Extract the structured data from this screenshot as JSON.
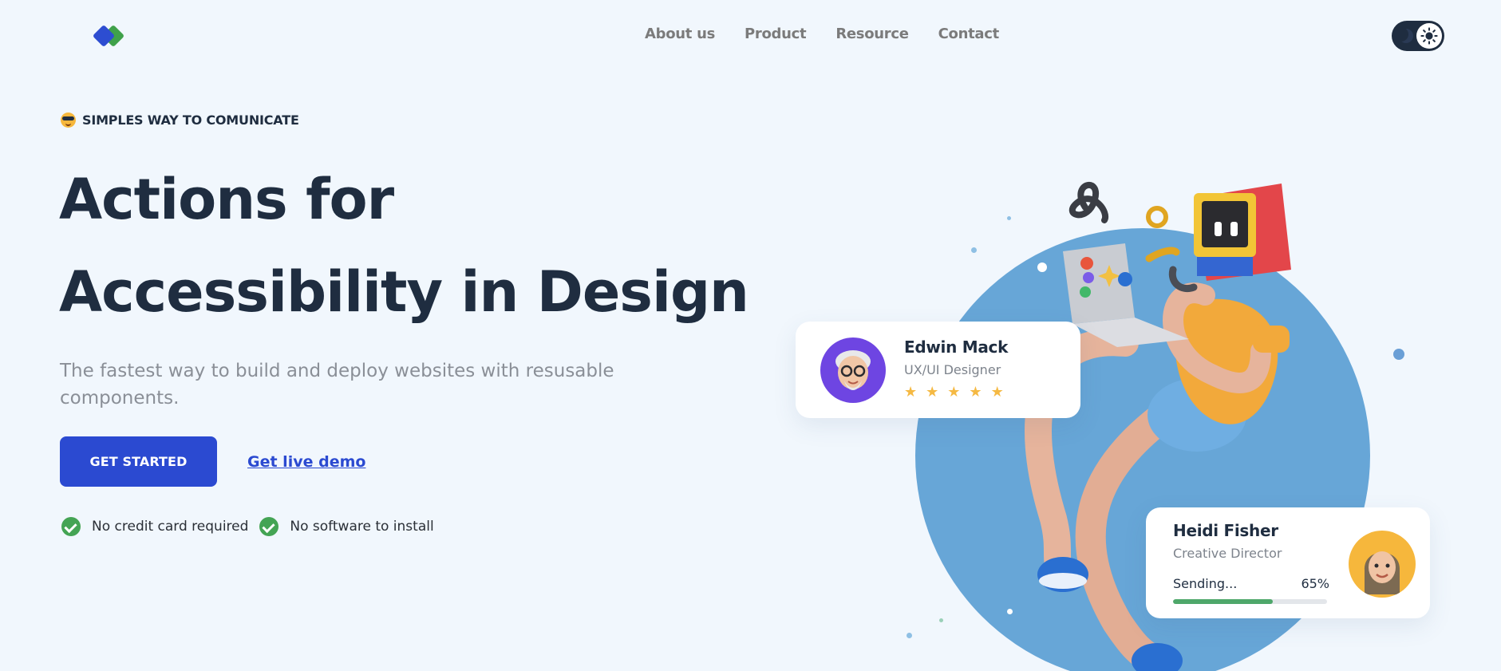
{
  "nav": {
    "items": [
      {
        "label": "About us"
      },
      {
        "label": "Product"
      },
      {
        "label": "Resource"
      },
      {
        "label": "Contact"
      }
    ],
    "logo_icon": "diamond-logo-icon",
    "theme_toggle_icon": "sun-icon"
  },
  "hero": {
    "tagline": "SIMPLES WAY TO COMUNICATE",
    "tagline_icon": "sunglasses-emoji-icon",
    "headline_line1": "Actions for",
    "headline_line2": "Accessibility in Design",
    "subtitle": "The fastest way to build and deploy websites with resusable components.",
    "cta_primary": "GET STARTED",
    "cta_secondary": "Get live demo",
    "checks": [
      {
        "label": "No credit card required"
      },
      {
        "label": "No software to install"
      }
    ]
  },
  "cards": {
    "edwin": {
      "name": "Edwin Mack",
      "role": "UX/UI Designer",
      "rating": 5
    },
    "heidi": {
      "name": "Heidi Fisher",
      "role": "Creative Director",
      "sending_label": "Sending...",
      "progress_text": "65%",
      "progress": 0.65
    }
  },
  "colors": {
    "primary": "#2b4ad1",
    "accent_green": "#44a454",
    "background": "#f1f7fd",
    "heading": "#1f2d40",
    "circle": "#67a6d7",
    "star": "#f5b943"
  }
}
